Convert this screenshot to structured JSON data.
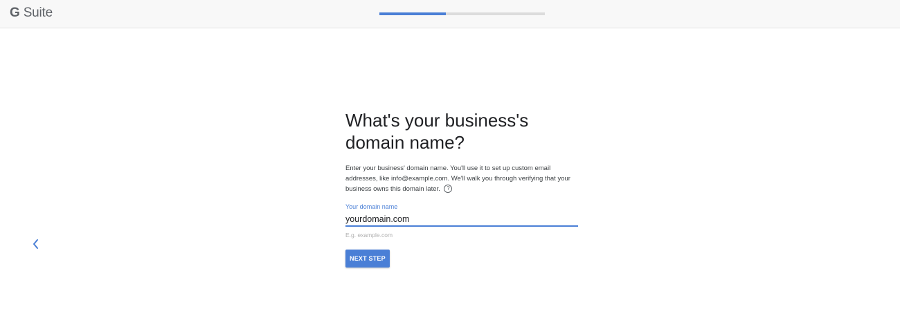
{
  "header": {
    "logo_g": "G",
    "logo_suite": "Suite",
    "progress": 0.4
  },
  "icons": {
    "back": "chevron-left-icon",
    "help": "question-circle-icon"
  },
  "colors": {
    "accent": "#4a7fd6",
    "track": "#dcdcdc",
    "header_bg": "#f8f8f8"
  },
  "main": {
    "title": "What's your business's domain name?",
    "description": "Enter your business' domain name. You'll use it to set up custom email addresses, like info@example.com. We'll walk you through verifying that your business owns this domain later.",
    "field_label": "Your domain name",
    "field_value": "yourdomain.com",
    "field_hint": "E.g. example.com",
    "next_label": "NEXT STEP"
  }
}
